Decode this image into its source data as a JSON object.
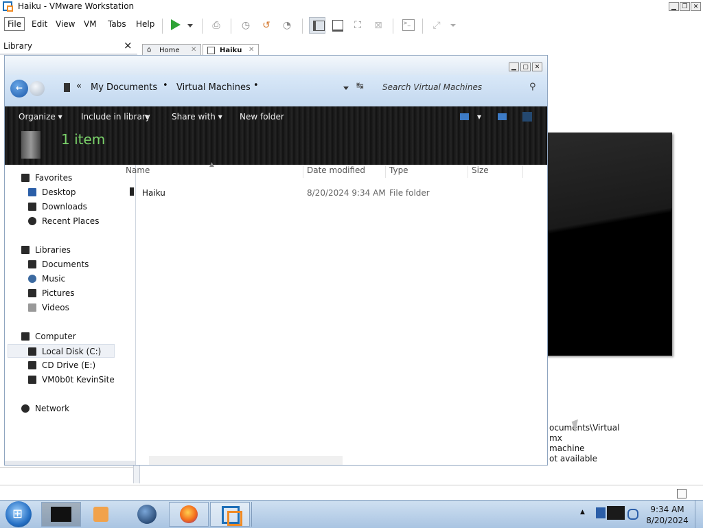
{
  "vmware": {
    "title": "Haiku - VMware Workstation",
    "menu": [
      "File",
      "Edit",
      "View",
      "VM",
      "Tabs",
      "Help"
    ],
    "library_label": "Library",
    "library_close": "×",
    "tabs": [
      {
        "label": "Home"
      },
      {
        "label": "Haiku"
      }
    ],
    "vm_info_lines": [
      "ocuments\\Virtual",
      "mx",
      "machine",
      "ot available"
    ]
  },
  "explorer": {
    "breadcrumb": {
      "chevron": "«",
      "part1": "My Documents",
      "part2": "Virtual Machines"
    },
    "search_placeholder": "Search Virtual Machines",
    "toolbar": {
      "organize": "Organize",
      "include": "Include in library",
      "share": "Share with",
      "new_folder": "New folder"
    },
    "item_count": "1 item",
    "columns": {
      "name": "Name",
      "date": "Date modified",
      "type": "Type",
      "size": "Size"
    },
    "files": [
      {
        "name": "Haiku",
        "date": "8/20/2024 9:34 AM",
        "type": "File folder",
        "size": ""
      }
    ],
    "nav": {
      "favorites": "Favorites",
      "desktop": "Desktop",
      "downloads": "Downloads",
      "recent": "Recent Places",
      "libraries": "Libraries",
      "documents": "Documents",
      "music": "Music",
      "pictures": "Pictures",
      "videos": "Videos",
      "computer": "Computer",
      "local_disk": "Local Disk (C:)",
      "cd_drive": "CD Drive (E:)",
      "vm_share": "VM0b0t KevinSite",
      "network": "Network"
    }
  },
  "taskbar": {
    "time": "9:34 AM",
    "date": "8/20/2024",
    "arrow": "▲"
  },
  "colors": {
    "accent": "#1d6fb8",
    "toolbar_dark": "#151515",
    "item_count_green": "#7bd36a"
  }
}
